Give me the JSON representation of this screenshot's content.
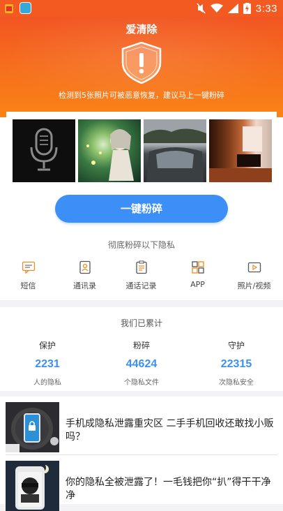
{
  "status_bar": {
    "time": "3:33"
  },
  "hero": {
    "title": "爱清除",
    "warning": "检测到5张照片可被恶意恢复，建议马上一键粉碎"
  },
  "shred_button": "一键粉碎",
  "thorough_label": "彻底粉碎以下隐私",
  "categories": [
    {
      "label": "短信",
      "icon": "sms-icon"
    },
    {
      "label": "通讯录",
      "icon": "contacts-icon"
    },
    {
      "label": "通话记录",
      "icon": "call-log-icon"
    },
    {
      "label": "APP",
      "icon": "app-grid-icon"
    },
    {
      "label": "照片/视频",
      "icon": "photo-video-icon"
    }
  ],
  "stats": {
    "heading": "我们已累计",
    "items": [
      {
        "key": "保护",
        "value": "2231",
        "unit": "人的隐私"
      },
      {
        "key": "粉碎",
        "value": "44624",
        "unit": "个隐私文件"
      },
      {
        "key": "守护",
        "value": "22315",
        "unit": "次隐私安全"
      }
    ]
  },
  "news": [
    {
      "title": "手机成隐私泄露重灾区 二手手机回收还敢找小贩吗？"
    },
    {
      "title": "你的隐私全被泄露了！一毛钱把你“扒”得干干净净"
    }
  ],
  "colors": {
    "hero_orange": "#f25a22",
    "accent_blue": "#3b8ff7"
  }
}
